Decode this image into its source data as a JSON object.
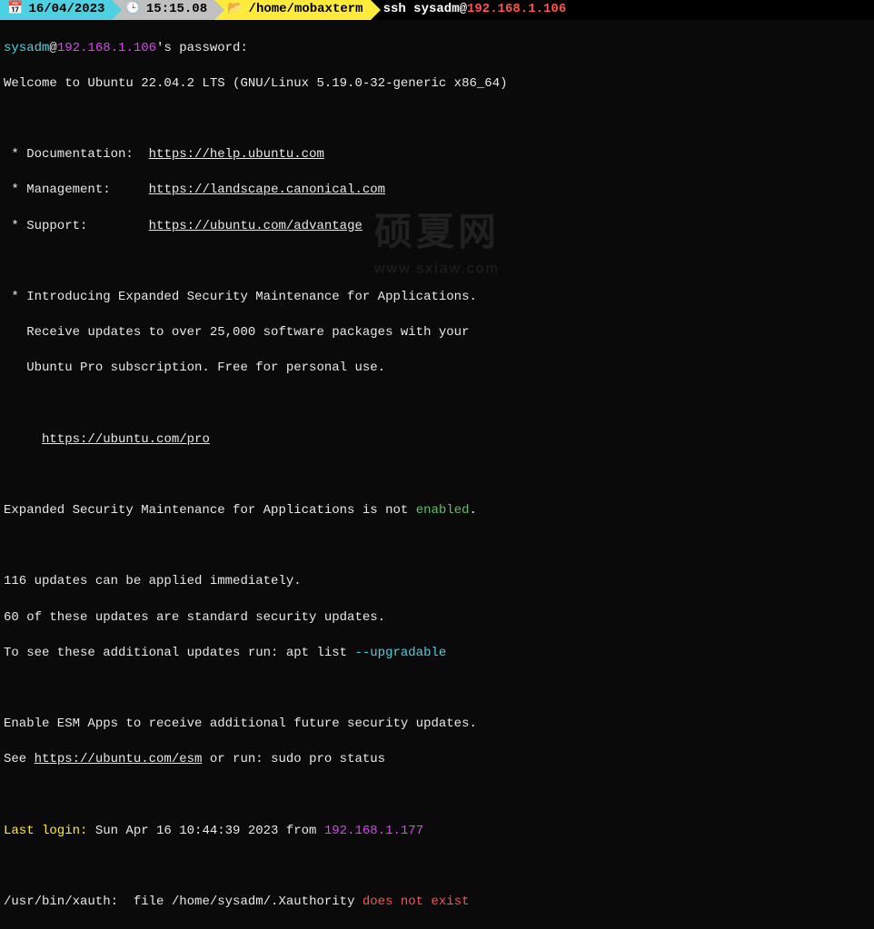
{
  "topbar": {
    "date": "16/04/2023",
    "time": "15:15.08",
    "path": "/home/mobaxterm",
    "cmd_prefix": "ssh sysadm@",
    "cmd_ip": "192.168.1.106"
  },
  "prompt": {
    "user": "sysadm",
    "at": "@",
    "host": "192.168.1.106",
    "suffix": "'s password:"
  },
  "welcome": "Welcome to Ubuntu 22.04.2 LTS (GNU/Linux 5.19.0-32-generic x86_64)",
  "links": {
    "doc_lbl": " * Documentation:  ",
    "doc_url": "https://help.ubuntu.com",
    "mgmt_lbl": " * Management:     ",
    "mgmt_url": "https://landscape.canonical.com",
    "sup_lbl": " * Support:        ",
    "sup_url": "https://ubuntu.com/advantage"
  },
  "esm_intro": {
    "l1": " * Introducing Expanded Security Maintenance for Applications.",
    "l2": "   Receive updates to over 25,000 software packages with your",
    "l3": "   Ubuntu Pro subscription. Free for personal use.",
    "url_indent": "     ",
    "url": "https://ubuntu.com/pro"
  },
  "esm_status": {
    "pre": "Expanded Security Maintenance for Applications is not ",
    "word": "enabled",
    "post": "."
  },
  "updates": {
    "l1": "116 updates can be applied immediately.",
    "l2": "60 of these updates are standard security updates.",
    "l3_pre": "To see these additional updates run: apt list ",
    "l3_flag": "--upgradable"
  },
  "enable_esm": {
    "l1": "Enable ESM Apps to receive additional future security updates.",
    "l2_pre": "See ",
    "l2_url": "https://ubuntu.com/esm",
    "l2_post": " or run: sudo pro status"
  },
  "lastlogin": {
    "label": "Last login:",
    "text": " Sun Apr 16 10:44:39 2023 from ",
    "ip": "192.168.1.177"
  },
  "xauth": {
    "path": "/usr/bin/xauth:",
    "mid": "  file /home/sysadm/.Xauthority ",
    "err": "does not exist"
  },
  "watermark": {
    "big": "硕夏网",
    "small": "www.sxiaw.com"
  }
}
